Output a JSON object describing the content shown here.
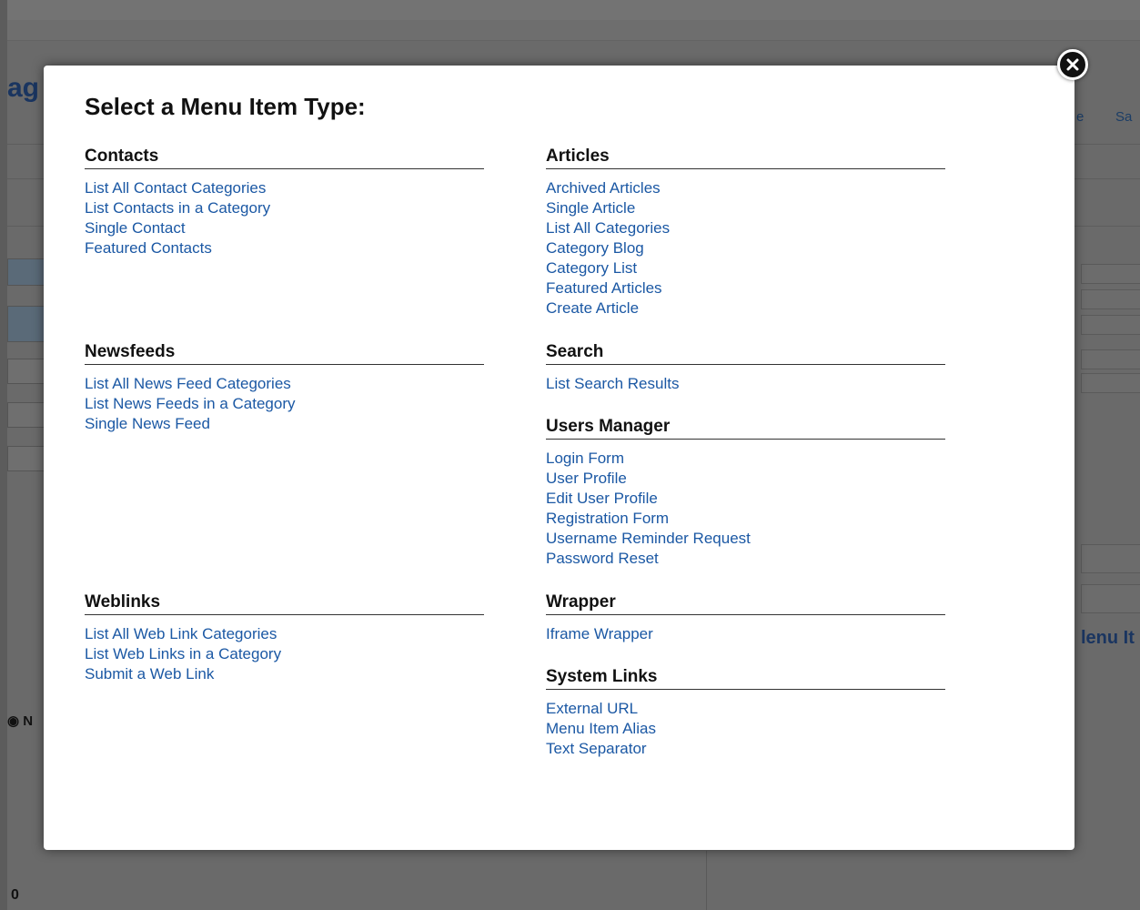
{
  "background": {
    "title_fragment": "ag",
    "save_fragment": "Sa",
    "e_fragment": "e",
    "menu_item_fragment": "lenu It",
    "radio_fragment": "N",
    "counter": "0"
  },
  "modal": {
    "title": "Select a Menu Item Type:",
    "close_icon": "close-icon",
    "groups": {
      "contacts": {
        "heading": "Contacts",
        "items": [
          "List All Contact Categories",
          "List Contacts in a Category",
          "Single Contact",
          "Featured Contacts"
        ]
      },
      "articles": {
        "heading": "Articles",
        "items": [
          "Archived Articles",
          "Single Article",
          "List All Categories",
          "Category Blog",
          "Category List",
          "Featured Articles",
          "Create Article"
        ]
      },
      "newsfeeds": {
        "heading": "Newsfeeds",
        "items": [
          "List All News Feed Categories",
          "List News Feeds in a Category",
          "Single News Feed"
        ]
      },
      "search": {
        "heading": "Search",
        "items": [
          "List Search Results"
        ]
      },
      "users": {
        "heading": "Users Manager",
        "items": [
          "Login Form",
          "User Profile",
          "Edit User Profile",
          "Registration Form",
          "Username Reminder Request",
          "Password Reset"
        ]
      },
      "weblinks": {
        "heading": "Weblinks",
        "items": [
          "List All Web Link Categories",
          "List Web Links in a Category",
          "Submit a Web Link"
        ]
      },
      "wrapper": {
        "heading": "Wrapper",
        "items": [
          "Iframe Wrapper"
        ]
      },
      "system": {
        "heading": "System Links",
        "items": [
          "External URL",
          "Menu Item Alias",
          "Text Separator"
        ]
      }
    }
  },
  "colors": {
    "link": "#1b58a4",
    "overlay": "#6a6a6a",
    "modal_bg": "#ffffff"
  }
}
